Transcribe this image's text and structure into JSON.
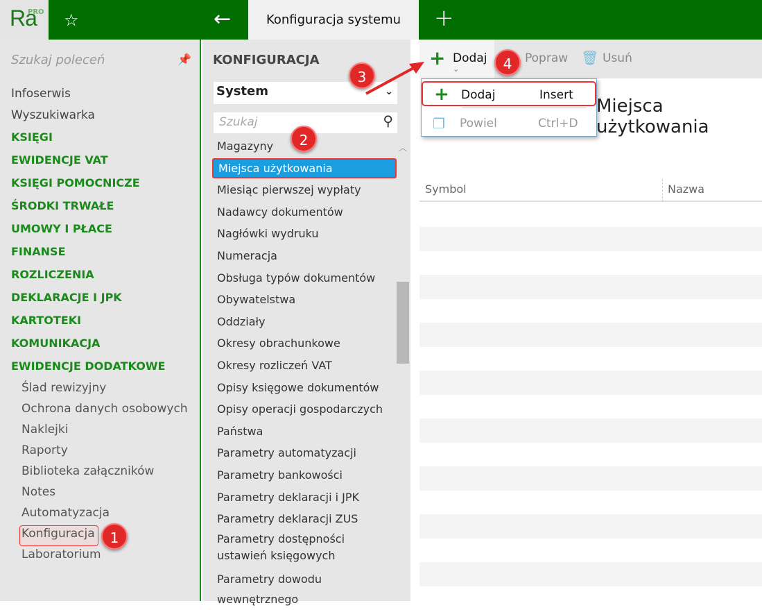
{
  "header": {
    "logo": "Ra",
    "logo_sup": "PRO",
    "tab_title": "Konfiguracja systemu"
  },
  "left": {
    "search_placeholder": "Szukaj poleceń",
    "items": [
      {
        "label": "Infoserwis",
        "type": "plain"
      },
      {
        "label": "Wyszukiwarka",
        "type": "plain"
      },
      {
        "label": "KSIĘGI",
        "type": "cat"
      },
      {
        "label": "EWIDENCJE VAT",
        "type": "cat"
      },
      {
        "label": "KSIĘGI POMOCNICZE",
        "type": "cat"
      },
      {
        "label": "ŚRODKI TRWAŁE",
        "type": "cat"
      },
      {
        "label": "UMOWY I PŁACE",
        "type": "cat"
      },
      {
        "label": "FINANSE",
        "type": "cat"
      },
      {
        "label": "ROZLICZENIA",
        "type": "cat"
      },
      {
        "label": "DEKLARACJE I JPK",
        "type": "cat"
      },
      {
        "label": "KARTOTEKI",
        "type": "cat"
      },
      {
        "label": "KOMUNIKACJA",
        "type": "cat"
      },
      {
        "label": "EWIDENCJE DODATKOWE",
        "type": "cat"
      },
      {
        "label": "Ślad rewizyjny",
        "type": "sub"
      },
      {
        "label": "Ochrona danych osobowych",
        "type": "sub"
      },
      {
        "label": "Naklejki",
        "type": "sub"
      },
      {
        "label": "Raporty",
        "type": "sub"
      },
      {
        "label": "Biblioteka załączników",
        "type": "sub"
      },
      {
        "label": "Notes",
        "type": "sub"
      },
      {
        "label": "Automatyzacja",
        "type": "sub"
      },
      {
        "label": "Konfiguracja",
        "type": "sub"
      },
      {
        "label": "Laboratorium",
        "type": "sub"
      }
    ]
  },
  "middle": {
    "heading": "KONFIGURACJA",
    "select_value": "System",
    "search_placeholder": "Szukaj",
    "items": [
      "Magazyny",
      "Miejsca użytkowania",
      "Miesiąc pierwszej wypłaty",
      "Nadawcy dokumentów",
      "Nagłówki wydruku",
      "Numeracja",
      "Obsługa typów dokumentów",
      "Obywatelstwa",
      "Oddziały",
      "Okresy obrachunkowe",
      "Okresy rozliczeń VAT",
      "Opisy księgowe dokumentów",
      "Opisy operacji gospodarczych",
      "Państwa",
      "Parametry automatyzacji",
      "Parametry bankowości",
      "Parametry deklaracji i JPK",
      "Parametry deklaracji ZUS",
      "Parametry dostępności ustawień księgowych",
      "Parametry dowodu wewnętrznego"
    ],
    "active_index": 1
  },
  "toolbar": {
    "add": "Dodaj",
    "edit": "Popraw",
    "delete": "Usuń"
  },
  "content": {
    "title": "Miejsca użytkowania",
    "columns": [
      "Symbol",
      "Nazwa"
    ]
  },
  "menu": {
    "items": [
      {
        "label": "Dodaj",
        "shortcut": "Insert"
      },
      {
        "label": "Powiel",
        "shortcut": "Ctrl+D"
      }
    ]
  },
  "badges": [
    "1",
    "2",
    "3",
    "4"
  ],
  "colors": {
    "brand": "#006e00",
    "accent": "#1a9ee0",
    "annotation": "#e02828"
  }
}
